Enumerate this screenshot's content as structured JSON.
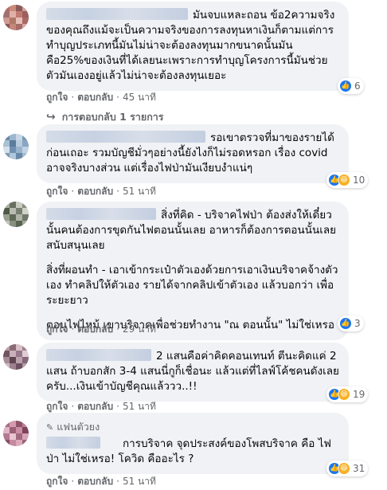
{
  "comments": [
    {
      "text_after_name": "มันจบแหละถอน ข้อ2ความจริงของคุณถึงแม้จะเป็นความจริงของการลงทุนหาเงินก็ตามแต่การทำบุญประเภทนี้มันไม่น่าจะต้องลงทุนมากขนาดนั้นมันคือ25%ของเงินที่ได้เลยนะเพราะการทำบุญโครงการนี้มันช่วยตัวมันเองอยู่แล้วไม่น่าจะต้องลงทุนเยอะ",
      "like_label": "ถูกใจ",
      "reply_label": "ตอบกลับ",
      "time": "45 นาที",
      "reaction_count": "6",
      "reaction_icons": [
        "like-icon"
      ]
    },
    {
      "text_after_name": "รอเขาตรวจที่มาของรายได้ก่อนเถอะ รวมบัญชีมั่วๆอย่างนี้ยังไงก็ไม่รอดหรอก เรื่อง covid อาจจริงบางส่วน แต่เรื่องไฟป่ามันเงียบงำแน่ๆ",
      "like_label": "ถูกใจ",
      "reply_label": "ตอบกลับ",
      "time": "51 นาที",
      "reaction_count": "10",
      "reaction_icons": [
        "like-icon",
        "haha-icon"
      ]
    },
    {
      "text_after_name": "สิ่งที่คิด - บริจาคไฟป่า ต้องส่งให้เดี๋ยวนั้นคนต้องการขุดกันไฟตอนนั้นเลย อาหารก็ต้องการตอนนั้นเลยสนับสนุนเลย",
      "para2": "สิ่งที่ผอนทำ - เอาเข้ากระเป๋าตัวเองด้วยการเอาเงินบริจาคจ้างตัวเอง ทำคลิปให้ตัวเอง รายได้จากคลิปเข้าตัวเอง แล้วบอกว่า เพื่อระยะยาว",
      "para3": "ตอนไฟไหม้ เขาบริจาคเพื่อช่วยทำงาน \"ณ ตอนนั้น\" ไม่ใช่เหรอ",
      "like_label": "ถูกใจ",
      "reply_label": "ตอบกลับ",
      "time": "29 นาที",
      "reaction_count": "3",
      "reaction_icons": [
        "like-icon"
      ]
    },
    {
      "text_after_name": "2 แสนคือค่าคิดคอนเทนท์ ตีนะคิดแค่ 2 แสน ถ้าบอกสัก 3-4 แสนนี่กูก็เชื่อนะ แล้วแต่ที่ไลฟ์โค้ชคนดังเลยครับ...เงินเข้าบัญชีคุณแล้ววว..!!",
      "like_label": "ถูกใจ",
      "reply_label": "ตอบกลับ",
      "time": "51 นาที",
      "reaction_count": "19",
      "reaction_icons": [
        "like-icon",
        "haha-icon"
      ]
    },
    {
      "badge": "แฟนตัวยง",
      "text_after_name": "การบริจาค จุดประสงค์ของโพสบริจาค คือ ไฟป่า ไม่ใช่เหรอ! โควิด คืออะไร ?",
      "like_label": "ถูกใจ",
      "reply_label": "ตอบกลับ",
      "time": "51 นาที",
      "reaction_count": "31",
      "reaction_icons": [
        "like-icon",
        "haha-icon"
      ]
    }
  ],
  "replies_link": "การตอบกลับ 1 รายการ",
  "colors": {
    "bubble": "#f0f2f5",
    "meta": "#65676b",
    "like": "#1877f2",
    "haha": "#f7b125"
  }
}
